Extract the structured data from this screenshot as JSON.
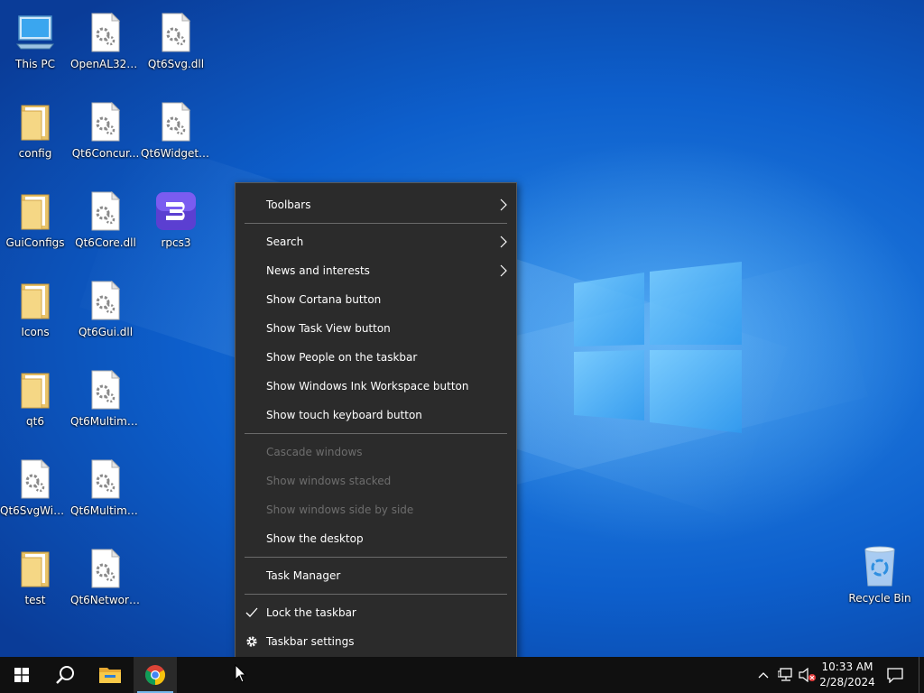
{
  "desktop": {
    "icons": [
      {
        "label": "This PC",
        "icon": "computer-icon"
      },
      {
        "label": "OpenAL32.dll",
        "icon": "dll-file-icon"
      },
      {
        "label": "Qt6Svg.dll",
        "icon": "dll-file-icon"
      },
      {
        "label": "config",
        "icon": "folder-icon"
      },
      {
        "label": "Qt6Concur...",
        "icon": "dll-file-icon"
      },
      {
        "label": "Qt6Widgets...",
        "icon": "dll-file-icon"
      },
      {
        "label": "GuiConfigs",
        "icon": "folder-icon"
      },
      {
        "label": "Qt6Core.dll",
        "icon": "dll-file-icon"
      },
      {
        "label": "rpcs3",
        "icon": "rpcs3-app-icon"
      },
      {
        "label": "Icons",
        "icon": "folder-icon"
      },
      {
        "label": "Qt6Gui.dll",
        "icon": "dll-file-icon"
      },
      {
        "label": "qt6",
        "icon": "folder-icon"
      },
      {
        "label": "Qt6Multime...",
        "icon": "dll-file-icon"
      },
      {
        "label": "Qt6SvgWid...",
        "icon": "dll-file-icon"
      },
      {
        "label": "Qt6Multime...",
        "icon": "dll-file-icon"
      },
      {
        "label": "test",
        "icon": "folder-icon"
      },
      {
        "label": "Qt6Network...",
        "icon": "dll-file-icon"
      },
      {
        "label": "Recycle Bin",
        "icon": "recycle-bin-icon"
      }
    ]
  },
  "context_menu": {
    "items": [
      {
        "label": "Toolbars",
        "submenu": true,
        "enabled": true
      },
      {
        "label": "Search",
        "submenu": true,
        "enabled": true
      },
      {
        "label": "News and interests",
        "submenu": true,
        "enabled": true
      },
      {
        "label": "Show Cortana button",
        "enabled": true
      },
      {
        "label": "Show Task View button",
        "enabled": true
      },
      {
        "label": "Show People on the taskbar",
        "enabled": true
      },
      {
        "label": "Show Windows Ink Workspace button",
        "enabled": true
      },
      {
        "label": "Show touch keyboard button",
        "enabled": true
      },
      {
        "label": "Cascade windows",
        "enabled": false
      },
      {
        "label": "Show windows stacked",
        "enabled": false
      },
      {
        "label": "Show windows side by side",
        "enabled": false
      },
      {
        "label": "Show the desktop",
        "enabled": true
      },
      {
        "label": "Task Manager",
        "enabled": true
      },
      {
        "label": "Lock the taskbar",
        "enabled": true,
        "checked": true
      },
      {
        "label": "Taskbar settings",
        "enabled": true,
        "icon": "gear-icon"
      }
    ]
  },
  "taskbar": {
    "time": "10:33 AM",
    "date": "2/28/2024",
    "pinned": [
      "start-button",
      "search-button",
      "file-explorer",
      "chrome"
    ]
  },
  "colors": {
    "menu_bg": "#2b2b2b",
    "taskbar_bg": "#101010",
    "accent": "#76b9ed"
  }
}
